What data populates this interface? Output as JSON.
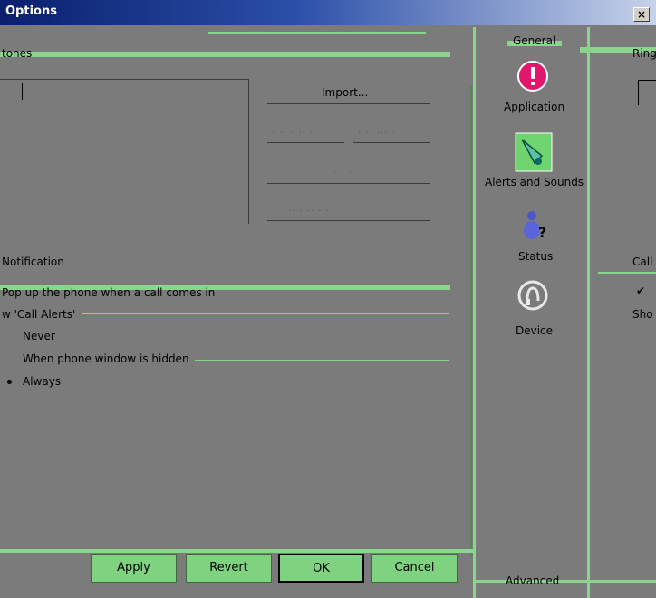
{
  "window": {
    "title": "Options",
    "close_glyph": "×"
  },
  "left": {
    "group_ringtones": "tones",
    "buttons": {
      "import": "Import...",
      "faint_1": "· ·· · ·· ·",
      "faint_2": "· ·· ··· ·",
      "faint_3": "· · ·",
      "faint_4": "·· · ·· · ·"
    },
    "notification_title": "Notification",
    "popup_checkbox": "Pop up the phone when a call comes in",
    "call_alerts_label": "w 'Call Alerts'",
    "options": [
      {
        "label": "Never",
        "selected": false
      },
      {
        "label": "When phone window is hidden",
        "selected": false
      },
      {
        "label": "Always",
        "selected": true
      }
    ]
  },
  "categories": {
    "header": "General",
    "items": [
      {
        "label": "Application",
        "icon": "alert-icon"
      },
      {
        "label": "Alerts and Sounds",
        "icon": "bell-icon"
      },
      {
        "label": "Status",
        "icon": "status-person-icon"
      },
      {
        "label": "Device",
        "icon": "headset-icon"
      }
    ],
    "footer": "Advanced"
  },
  "right": {
    "ring_label": "Ring",
    "call_label": "Call",
    "show_label": "Sho"
  },
  "bottom_buttons": {
    "apply": "Apply",
    "revert": "Revert",
    "ok": "OK",
    "cancel": "Cancel"
  },
  "colors": {
    "background": "#7b7b7b",
    "accent_green": "#8bd48b",
    "title_bar": "#0a1f6e"
  }
}
